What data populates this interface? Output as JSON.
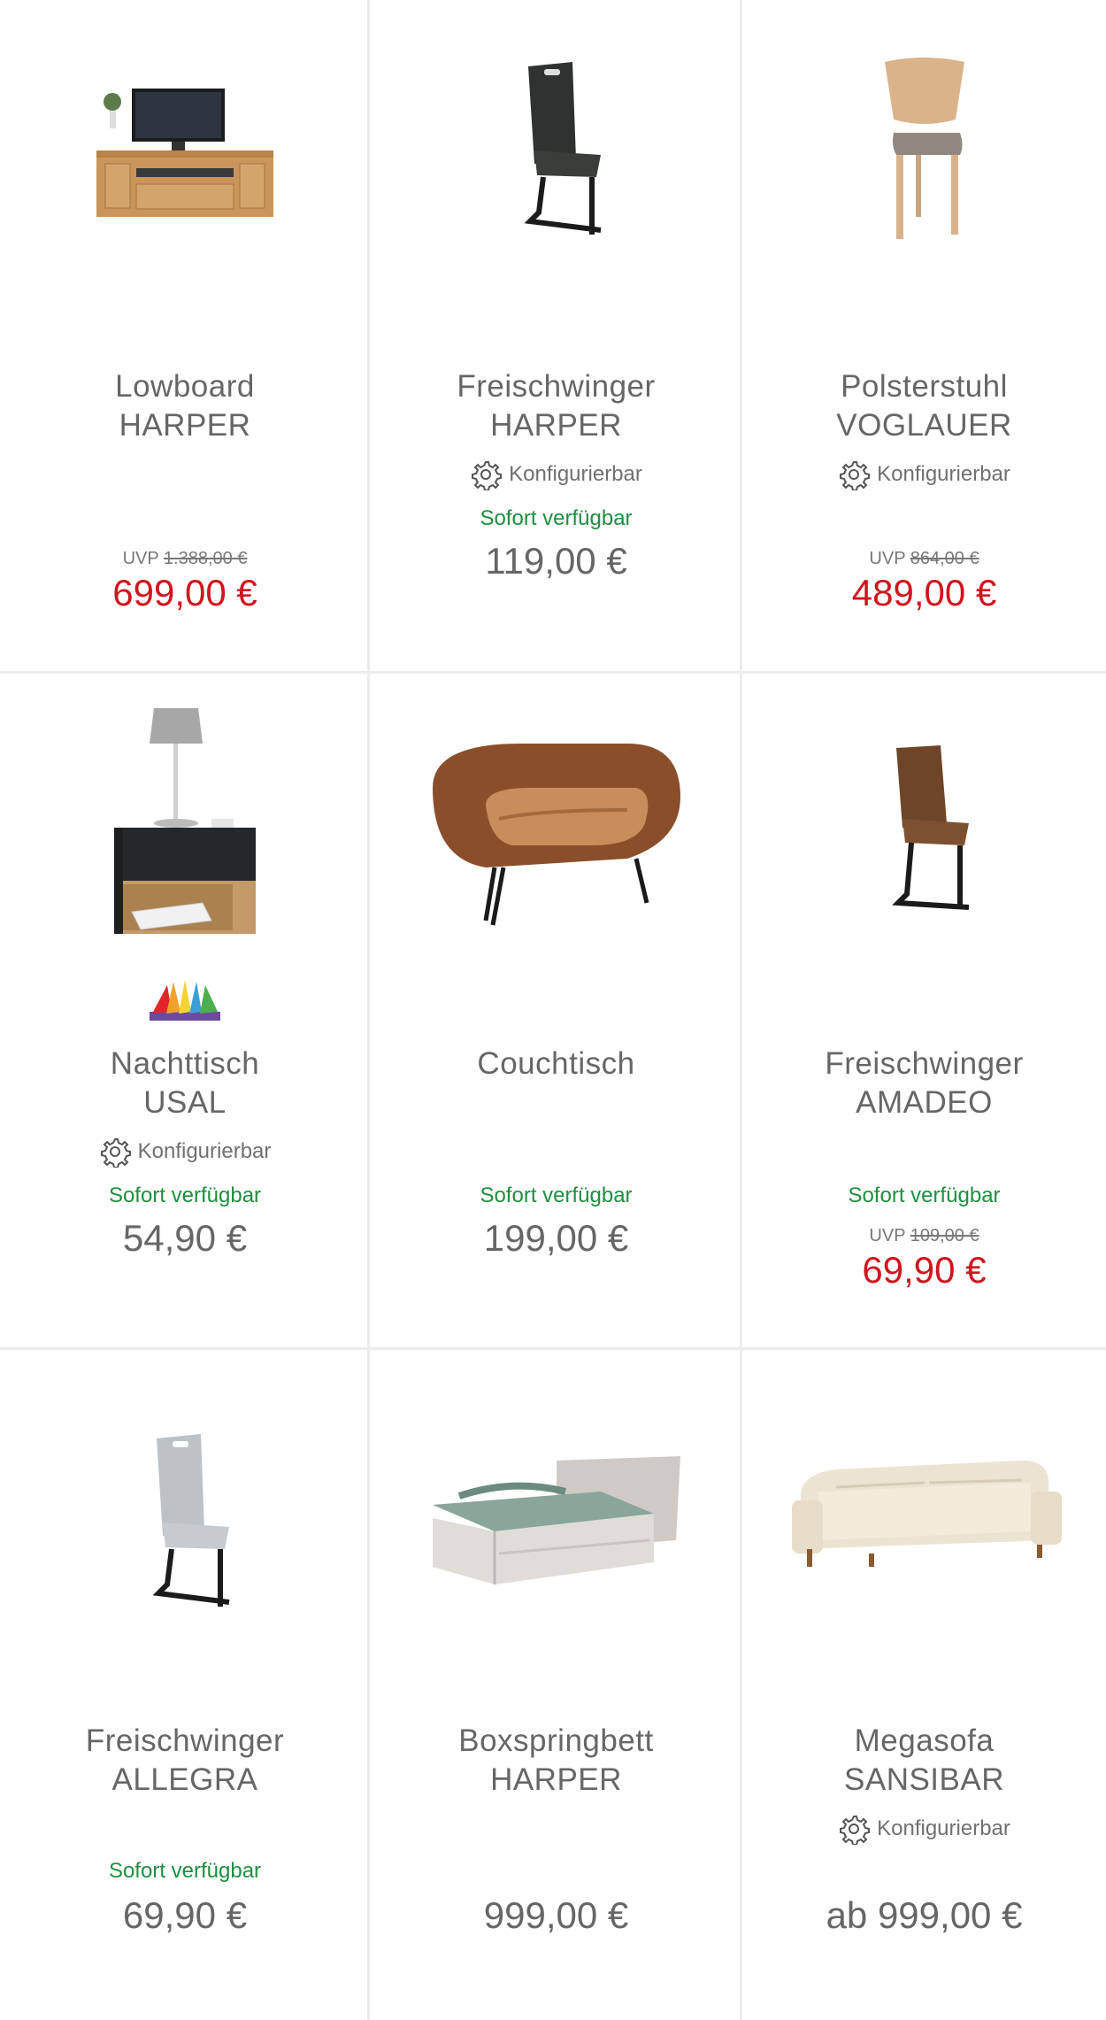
{
  "config_label": "Konfigurierbar",
  "available_label": "Sofort verfügbar",
  "uvp_label": "UVP",
  "products": [
    {
      "name1": "Lowboard",
      "name2": "HARPER",
      "uvp": "1.388,00 €",
      "price": "699,00 €",
      "image_icon": "lowboard-icon"
    },
    {
      "name1": "Freischwinger",
      "name2": "HARPER",
      "configurable": true,
      "available": true,
      "price": "119,00 €",
      "image_icon": "chair-icon"
    },
    {
      "name1": "Polsterstuhl",
      "name2": "VOGLAUER",
      "configurable": true,
      "uvp": "864,00 €",
      "price": "489,00 €",
      "image_icon": "chair-icon"
    },
    {
      "name1": "Nachttisch",
      "name2": "USAL",
      "configurable": true,
      "available": true,
      "price": "54,90 €",
      "image_icon": "nightstand-icon",
      "swatch_icon": "color-fan-icon"
    },
    {
      "name1": "Couchtisch",
      "name2": "",
      "available": true,
      "price": "199,00 €",
      "image_icon": "coffee-table-icon"
    },
    {
      "name1": "Freischwinger",
      "name2": "AMADEO",
      "available": true,
      "uvp": "109,00 €",
      "price": "69,90 €",
      "image_icon": "chair-icon"
    },
    {
      "name1": "Freischwinger",
      "name2": "ALLEGRA",
      "available": true,
      "price": "69,90 €",
      "image_icon": "chair-icon"
    },
    {
      "name1": "Boxspringbett",
      "name2": "HARPER",
      "price": "999,00 €",
      "image_icon": "bed-icon"
    },
    {
      "name1": "Megasofa",
      "name2": "SANSIBAR",
      "configurable": true,
      "price": "ab 999,00 €",
      "image_icon": "sofa-icon"
    }
  ],
  "colors": {
    "sale": "#d0141e",
    "available": "#1f8f3f",
    "text": "#666666"
  }
}
